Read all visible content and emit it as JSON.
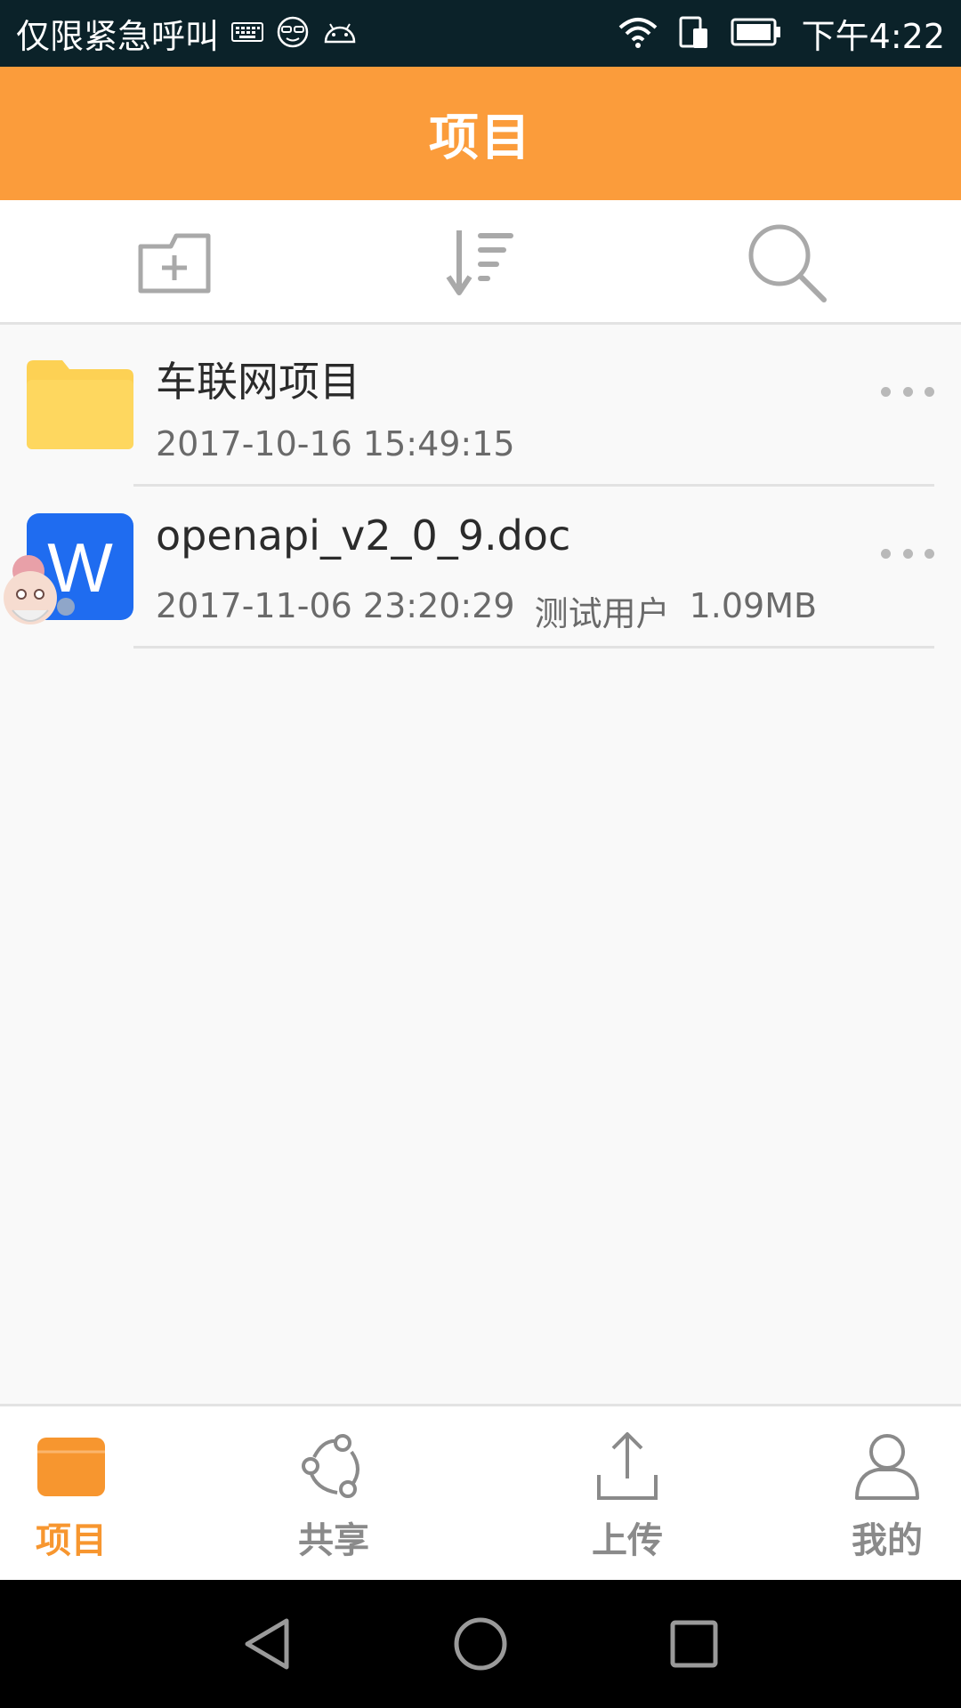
{
  "status_bar": {
    "carrier": "仅限紧急呼叫",
    "time": "下午4:22",
    "icons": [
      "keyboard-icon",
      "face-icon",
      "android-icon",
      "wifi-icon",
      "sim-icon",
      "battery-icon"
    ]
  },
  "header": {
    "title": "项目"
  },
  "toolbar": {
    "icons": [
      "new-folder-icon",
      "sort-icon",
      "search-icon"
    ]
  },
  "files": [
    {
      "name": "车联网项目",
      "date": "2017-10-16 15:49:15",
      "owner": "",
      "size": "",
      "type": "folder",
      "icon": "folder-icon"
    },
    {
      "name": "openapi_v2_0_9.doc",
      "date": "2017-11-06 23:20:29",
      "owner": "测试用户",
      "size": "1.09MB",
      "type": "doc",
      "icon": "word-doc-icon",
      "icon_letter": "W"
    }
  ],
  "bottom_nav": {
    "items": [
      {
        "label": "项目",
        "icon": "project-icon",
        "active": true
      },
      {
        "label": "共享",
        "icon": "share-icon",
        "active": false
      },
      {
        "label": "上传",
        "icon": "upload-icon",
        "active": false
      },
      {
        "label": "我的",
        "icon": "profile-icon",
        "active": false
      }
    ]
  },
  "colors": {
    "accent": "#fb9c3b",
    "status_bar": "#0b2229",
    "folder": "#fdd154",
    "word_blue": "#1f6cf0",
    "nav_active": "#f7962f",
    "nav_inactive": "#8a8a8a"
  }
}
